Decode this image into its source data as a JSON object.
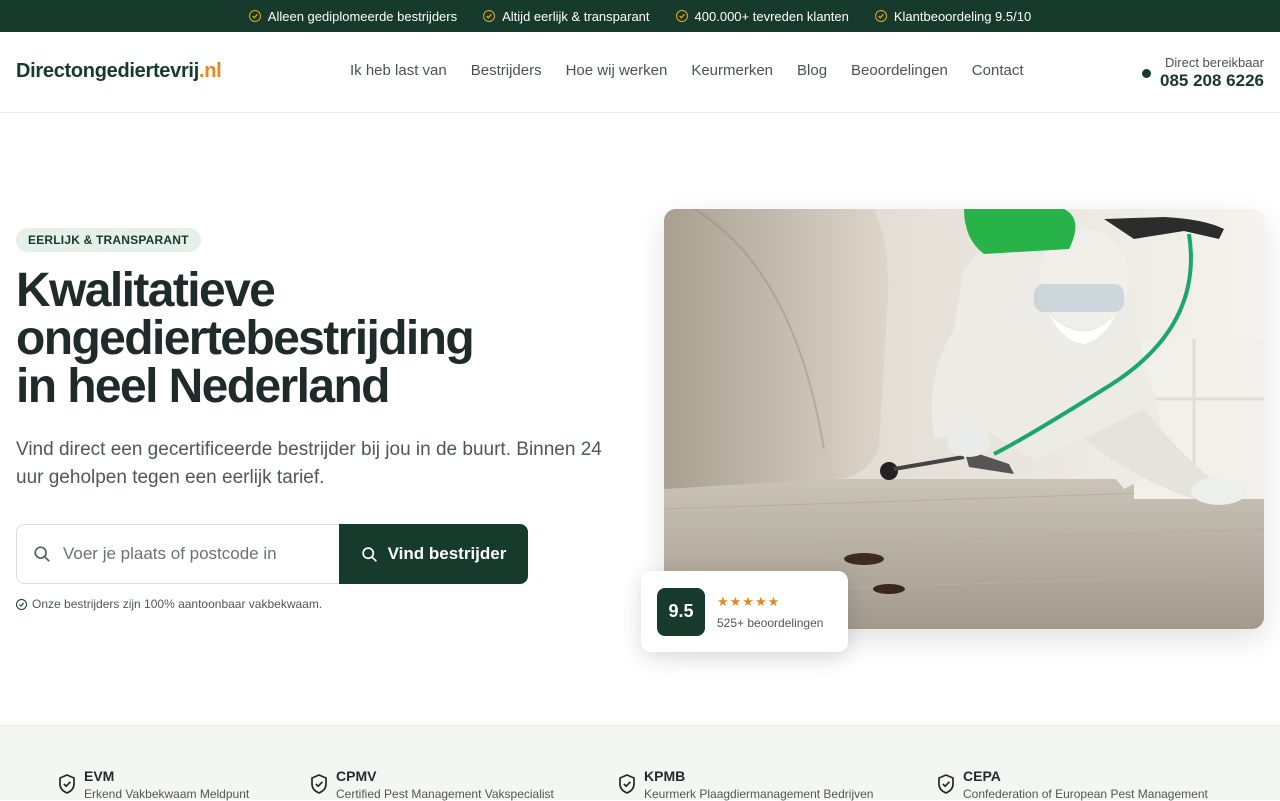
{
  "topbar": {
    "items": [
      "Alleen gediplomeerde bestrijders",
      "Altijd eerlijk & transparant",
      "400.000+ tevreden klanten",
      "Klantbeoordeling 9.5/10"
    ]
  },
  "header": {
    "logo_main": "Directongediertevrij",
    "logo_tld": ".nl",
    "nav": [
      "Ik heb last van",
      "Bestrijders",
      "Hoe wij werken",
      "Keurmerken",
      "Blog",
      "Beoordelingen",
      "Contact"
    ],
    "contact_label": "Direct bereikbaar",
    "contact_phone": "085 208 6226"
  },
  "hero": {
    "badge": "EERLIJK & TRANSPARANT",
    "title_line1": "Kwalitatieve",
    "title_line2": "ongediertebestrijding",
    "title_line3": "in heel Nederland",
    "subtitle": "Vind direct een gecertificeerde bestrijder bij jou in de buurt. Binnen 24 uur geholpen tegen een eerlijk tarief.",
    "search_placeholder": "Voer je plaats of postcode in",
    "search_value": "",
    "search_button": "Vind bestrijder",
    "note": "Onze bestrijders zijn 100% aantoonbaar vakbekwaam."
  },
  "rating": {
    "score": "9.5",
    "stars": "★★★★★",
    "count": "525+ beoordelingen"
  },
  "certifications": [
    {
      "code": "EVM",
      "name": "Erkend Vakbekwaam Meldpunt"
    },
    {
      "code": "CPMV",
      "name": "Certified Pest Management Vakspecialist"
    },
    {
      "code": "KPMB",
      "name": "Keurmerk Plaagdiermanagement Bedrijven"
    },
    {
      "code": "CEPA",
      "name": "Confederation of European Pest Management"
    }
  ],
  "colors": {
    "brand_dark_green": "#163a2b",
    "accent_orange": "#e8851e",
    "badge_bg": "#e6f0ea"
  }
}
